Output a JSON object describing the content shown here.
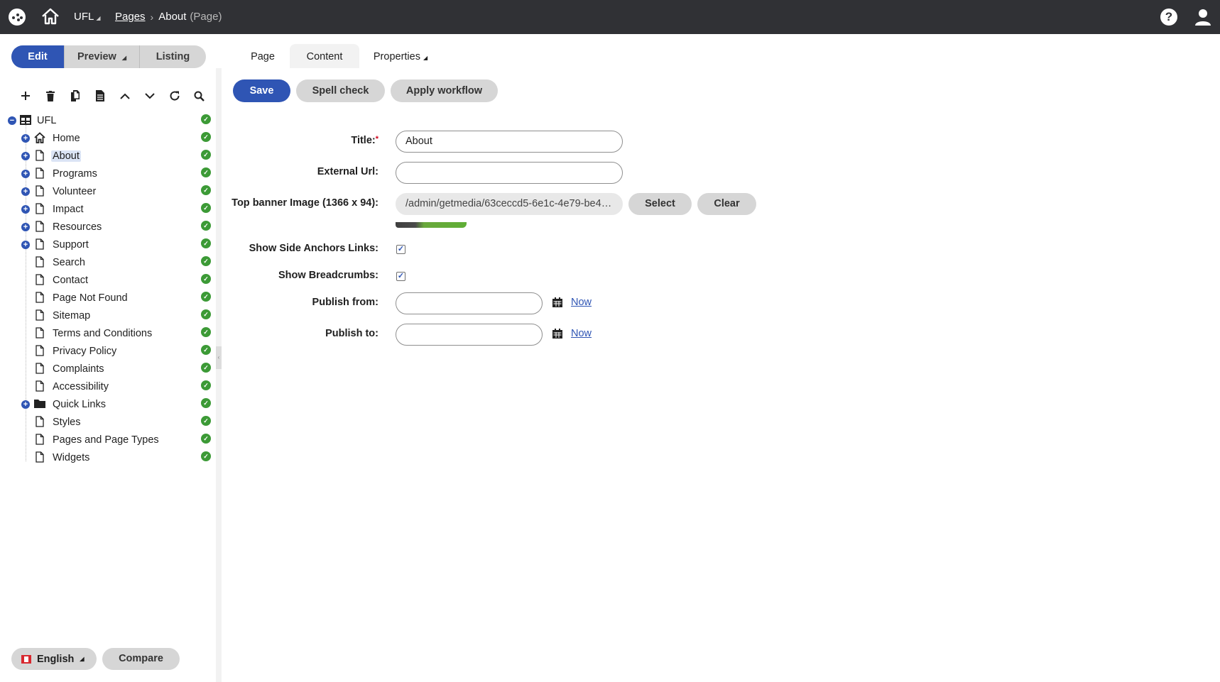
{
  "header": {
    "site": "UFL",
    "breadcrumb_link": "Pages",
    "current_page": "About",
    "current_page_type": "(Page)"
  },
  "modes": {
    "edit": "Edit",
    "preview": "Preview",
    "listing": "Listing"
  },
  "page_tabs": {
    "page": "Page",
    "content": "Content",
    "properties": "Properties"
  },
  "tree": {
    "root": "UFL",
    "items": [
      {
        "label": "Home",
        "icon": "home-icon",
        "expandable": true
      },
      {
        "label": "About",
        "icon": "page-icon",
        "expandable": true,
        "selected": true
      },
      {
        "label": "Programs",
        "icon": "page-icon",
        "expandable": true
      },
      {
        "label": "Volunteer",
        "icon": "page-icon",
        "expandable": true
      },
      {
        "label": "Impact",
        "icon": "page-icon",
        "expandable": true
      },
      {
        "label": "Resources",
        "icon": "page-icon",
        "expandable": true
      },
      {
        "label": "Support",
        "icon": "page-icon",
        "expandable": true
      },
      {
        "label": "Search",
        "icon": "page-icon",
        "expandable": false
      },
      {
        "label": "Contact",
        "icon": "page-icon",
        "expandable": false
      },
      {
        "label": "Page Not Found",
        "icon": "page-icon",
        "expandable": false
      },
      {
        "label": "Sitemap",
        "icon": "page-icon",
        "expandable": false
      },
      {
        "label": "Terms and Conditions",
        "icon": "page-icon",
        "expandable": false
      },
      {
        "label": "Privacy Policy",
        "icon": "page-icon",
        "expandable": false
      },
      {
        "label": "Complaints",
        "icon": "page-icon",
        "expandable": false
      },
      {
        "label": "Accessibility",
        "icon": "page-icon",
        "expandable": false
      },
      {
        "label": "Quick Links",
        "icon": "folder-icon",
        "expandable": true
      },
      {
        "label": "Styles",
        "icon": "page-icon",
        "expandable": false
      },
      {
        "label": "Pages and Page Types",
        "icon": "page-icon",
        "expandable": false
      },
      {
        "label": "Widgets",
        "icon": "page-icon",
        "expandable": false
      }
    ]
  },
  "footer": {
    "language": "English",
    "compare": "Compare"
  },
  "actions": {
    "save": "Save",
    "spell_check": "Spell check",
    "apply_workflow": "Apply workflow"
  },
  "form": {
    "title_label": "Title:",
    "title_required": "*",
    "title_value": "About",
    "external_url_label": "External Url:",
    "external_url_value": "",
    "banner_label": "Top banner Image (1366 x 94):",
    "banner_value": "/admin/getmedia/63ceccd5-6e1c-4e79-be44...",
    "select": "Select",
    "clear": "Clear",
    "side_anchors_label": "Show Side Anchors Links:",
    "side_anchors_checked": true,
    "breadcrumbs_label": "Show Breadcrumbs:",
    "breadcrumbs_checked": true,
    "publish_from_label": "Publish from:",
    "publish_from_value": "",
    "publish_to_label": "Publish to:",
    "publish_to_value": "",
    "now": "Now"
  },
  "colors": {
    "accent": "#2f55b4",
    "header_bg": "#303135",
    "status_ok": "#3c9a36"
  }
}
